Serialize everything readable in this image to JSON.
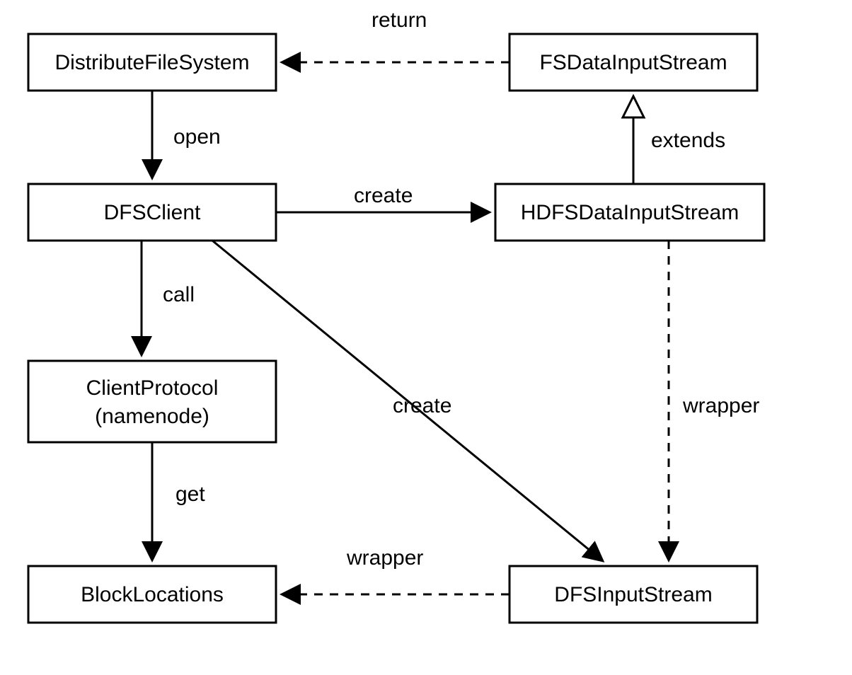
{
  "nodes": {
    "distributeFileSystem": {
      "label": "DistributeFileSystem"
    },
    "dfsClient": {
      "label": "DFSClient"
    },
    "clientProtocol": {
      "line1": "ClientProtocol",
      "line2": "(namenode)"
    },
    "blockLocations": {
      "label": "BlockLocations"
    },
    "fsDataInputStream": {
      "label": "FSDataInputStream"
    },
    "hdfsDataInputStream": {
      "label": "HDFSDataInputStream"
    },
    "dfsInputStream": {
      "label": "DFSInputStream"
    }
  },
  "edges": {
    "return": {
      "label": "return"
    },
    "open": {
      "label": "open"
    },
    "create1": {
      "label": "create"
    },
    "call": {
      "label": "call"
    },
    "extends": {
      "label": "extends"
    },
    "get": {
      "label": "get"
    },
    "create2": {
      "label": "create"
    },
    "wrapper1": {
      "label": "wrapper"
    },
    "wrapper2": {
      "label": "wrapper"
    }
  }
}
